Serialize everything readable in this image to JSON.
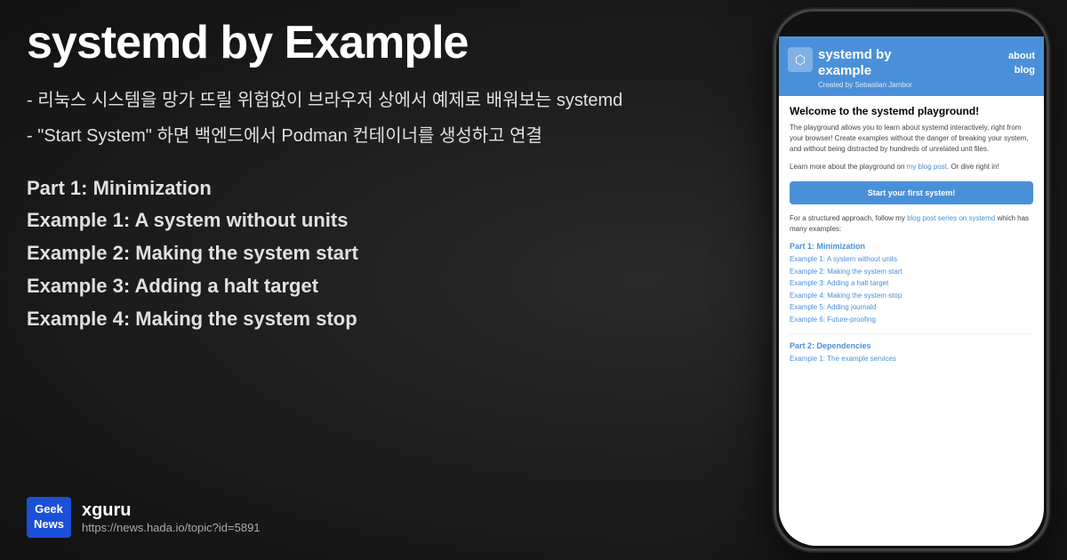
{
  "background": {
    "color": "#1a1a1a"
  },
  "main": {
    "title": "systemd by Example",
    "subtitle1": "- 리눅스 시스템을 망가 뜨릴 위험없이 브라우저 상에서 예제로 배워보는 systemd",
    "subtitle2": "- \"Start System\" 하면 백엔드에서 Podman 컨테이너를 생성하고 연결",
    "part_label": "Part 1: Minimization",
    "examples": [
      "Example 1: A system without units",
      "Example 2: Making the system start",
      "Example 3: Adding a halt target",
      "Example 4: Making the system stop"
    ]
  },
  "badge": {
    "line1": "Geek",
    "line2": "News",
    "username": "xguru",
    "url": "https://news.hada.io/topic?id=5891"
  },
  "phone": {
    "header": {
      "title": "systemd by\nexample",
      "tagline": "Created by Sebastian Jambor",
      "nav": [
        "about",
        "blog"
      ]
    },
    "welcome_title": "Welcome to the systemd playground!",
    "description": "The playground allows you to learn about systemd interactively, right from your browser! Create examples without the danger of breaking your system, and without being distracted by hundreds of unrelated unit files.",
    "learn_text": "Learn more about the playground on ",
    "learn_link": "my blog post",
    "learn_suffix": ". Or dive right in!",
    "start_button": "Start your first system!",
    "series_text": "For a structured approach, follow my ",
    "series_link": "blog post series on systemd",
    "series_suffix": " which has many examples:",
    "part1_label": "Part 1: Minimization",
    "part1_examples": [
      {
        "label": "Example 1: ",
        "link": "A system without units"
      },
      {
        "label": "Example 2: ",
        "link": "Making the system start"
      },
      {
        "label": "Example 3: ",
        "link": "Adding a halt target"
      },
      {
        "label": "Example 4: ",
        "link": "Making the system stop"
      },
      {
        "label": "Example 5: ",
        "link": "Adding journald"
      },
      {
        "label": "Example 6: ",
        "link": "Future-proofing"
      }
    ],
    "part2_label": "Part 2: Dependencies",
    "part2_examples": [
      {
        "label": "Example 1: ",
        "link": "The example services"
      }
    ]
  }
}
